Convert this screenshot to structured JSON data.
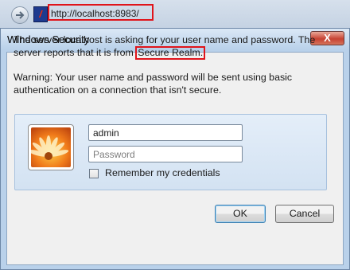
{
  "browser": {
    "url": "http://localhost:8983/",
    "site_icon_glyph": "/",
    "site_icon_letter": "f"
  },
  "dialog": {
    "title": "Windows Security",
    "close_glyph": "X",
    "message_part1": "The server localhost is asking for your user name and password. The server reports that it is from ",
    "realm": "Secure Realm.",
    "warning": "Warning: Your user name and password will be sent using basic authentication on a connection that isn't secure.",
    "username_value": "admin",
    "password_placeholder": "Password",
    "remember_label": "Remember my credentials",
    "remember_checked": false,
    "ok_label": "OK",
    "cancel_label": "Cancel"
  },
  "colors": {
    "highlight": "#e0141b",
    "dialog_frame": "#b9d1ea",
    "panel": "#dbe8f6"
  }
}
